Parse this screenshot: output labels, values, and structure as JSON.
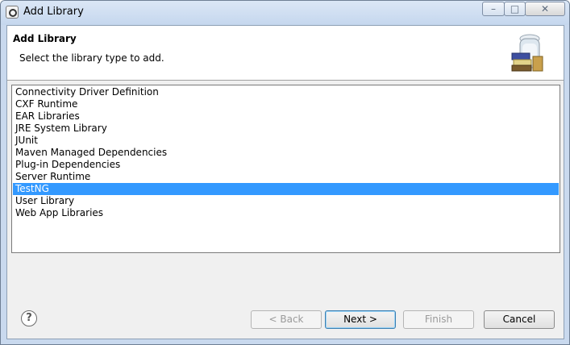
{
  "window": {
    "title": "Add Library",
    "minimize_glyph": "–",
    "maximize_glyph": "□",
    "close_glyph": "✕"
  },
  "banner": {
    "title": "Add Library",
    "description": "Select the library type to add."
  },
  "library_types": [
    {
      "label": "Connectivity Driver Definition",
      "selected": false
    },
    {
      "label": "CXF Runtime",
      "selected": false
    },
    {
      "label": "EAR Libraries",
      "selected": false
    },
    {
      "label": "JRE System Library",
      "selected": false
    },
    {
      "label": "JUnit",
      "selected": false
    },
    {
      "label": "Maven Managed Dependencies",
      "selected": false
    },
    {
      "label": "Plug-in Dependencies",
      "selected": false
    },
    {
      "label": "Server Runtime",
      "selected": false
    },
    {
      "label": "TestNG",
      "selected": true
    },
    {
      "label": "User Library",
      "selected": false
    },
    {
      "label": "Web App Libraries",
      "selected": false
    }
  ],
  "footer": {
    "help_glyph": "?",
    "back_label": "< Back",
    "next_label": "Next >",
    "finish_label": "Finish",
    "cancel_label": "Cancel"
  },
  "colors": {
    "selection": "#3399ff",
    "titlebar": "#c5d7ee"
  }
}
